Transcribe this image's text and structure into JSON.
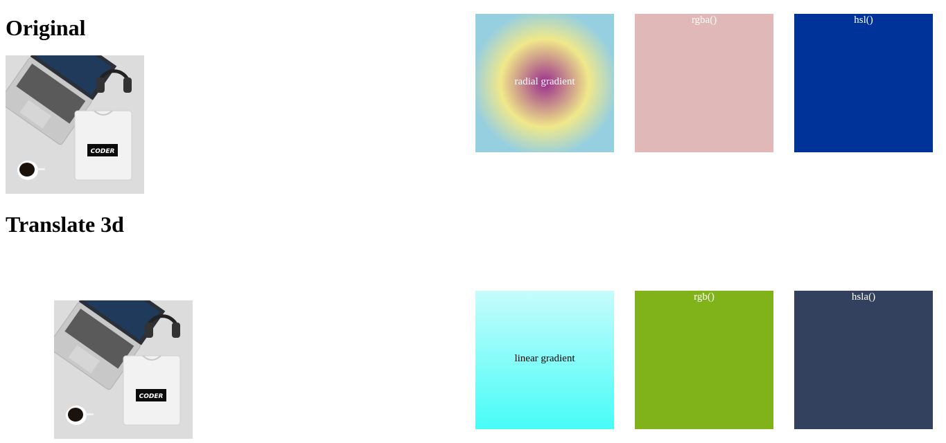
{
  "headings": {
    "original": "Original",
    "translate": "Translate 3d"
  },
  "image": {
    "tshirt_text": "CODER"
  },
  "boxes": {
    "radial": {
      "label": "radial gradient",
      "colors": [
        "#96cfe0",
        "#f0e88a",
        "#9b2d8c"
      ]
    },
    "rgba": {
      "label": "rgba()",
      "color": "#e0b8b8"
    },
    "hsl": {
      "label": "hsl()",
      "color": "#003399"
    },
    "linear": {
      "label": "linear gradient",
      "colors": [
        "#c6fcfc",
        "#47fcf7"
      ]
    },
    "rgb": {
      "label": "rgb()",
      "color": "#80b31a"
    },
    "hsla": {
      "label": "hsla()",
      "color": "#33415e"
    }
  }
}
